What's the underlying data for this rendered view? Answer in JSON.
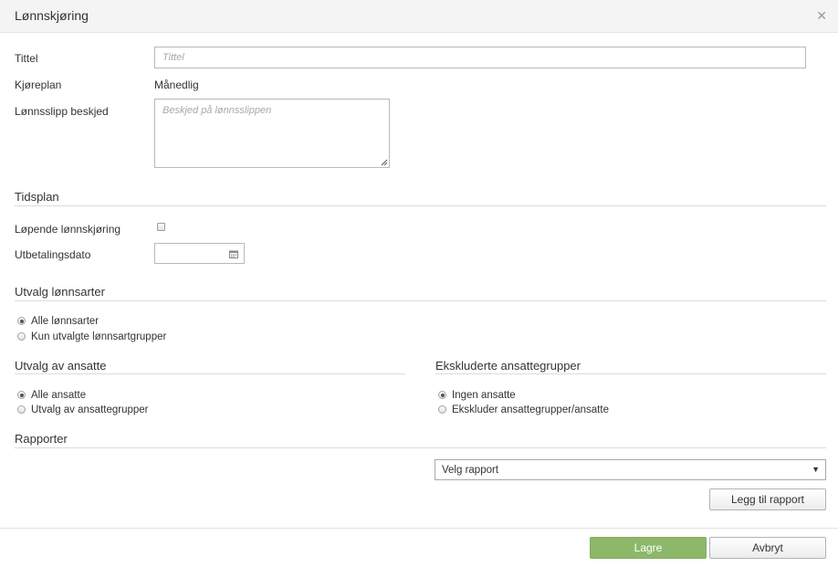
{
  "header": {
    "title": "Lønnskjøring",
    "close_icon": "close-icon"
  },
  "form": {
    "tittel_label": "Tittel",
    "tittel_placeholder": "Tittel",
    "tittel_value": "",
    "kjoreplan_label": "Kjøreplan",
    "kjoreplan_value": "Månedlig",
    "lonnsslipp_label": "Lønnsslipp beskjed",
    "lonnsslipp_placeholder": "Beskjed på lønnsslippen"
  },
  "tidsplan": {
    "title": "Tidsplan",
    "lopende_label": "Løpende lønnskjøring",
    "lopende_checked": false,
    "utbetalingsdato_label": "Utbetalingsdato",
    "utbetalingsdato_value": "",
    "calendar_icon": "calendar-icon"
  },
  "utvalg_lonnsarter": {
    "title": "Utvalg lønnsarter",
    "options": [
      {
        "label": "Alle lønnsarter",
        "checked": true
      },
      {
        "label": "Kun utvalgte lønnsartgrupper",
        "checked": false
      }
    ]
  },
  "utvalg_ansatte": {
    "title": "Utvalg av ansatte",
    "options": [
      {
        "label": "Alle ansatte",
        "checked": true
      },
      {
        "label": "Utvalg av ansattegrupper",
        "checked": false
      }
    ]
  },
  "ekskluderte": {
    "title": "Ekskluderte ansattegrupper",
    "options": [
      {
        "label": "Ingen ansatte",
        "checked": true
      },
      {
        "label": "Ekskluder ansattegrupper/ansatte",
        "checked": false
      }
    ]
  },
  "rapporter": {
    "title": "Rapporter",
    "select_value": "Velg rapport",
    "add_button": "Legg til rapport"
  },
  "footer": {
    "save_label": "Lagre",
    "cancel_label": "Avbryt"
  },
  "colors": {
    "primary_button": "#8db86a",
    "header_bg": "#f4f4f4",
    "divider": "#dcdcdc"
  }
}
